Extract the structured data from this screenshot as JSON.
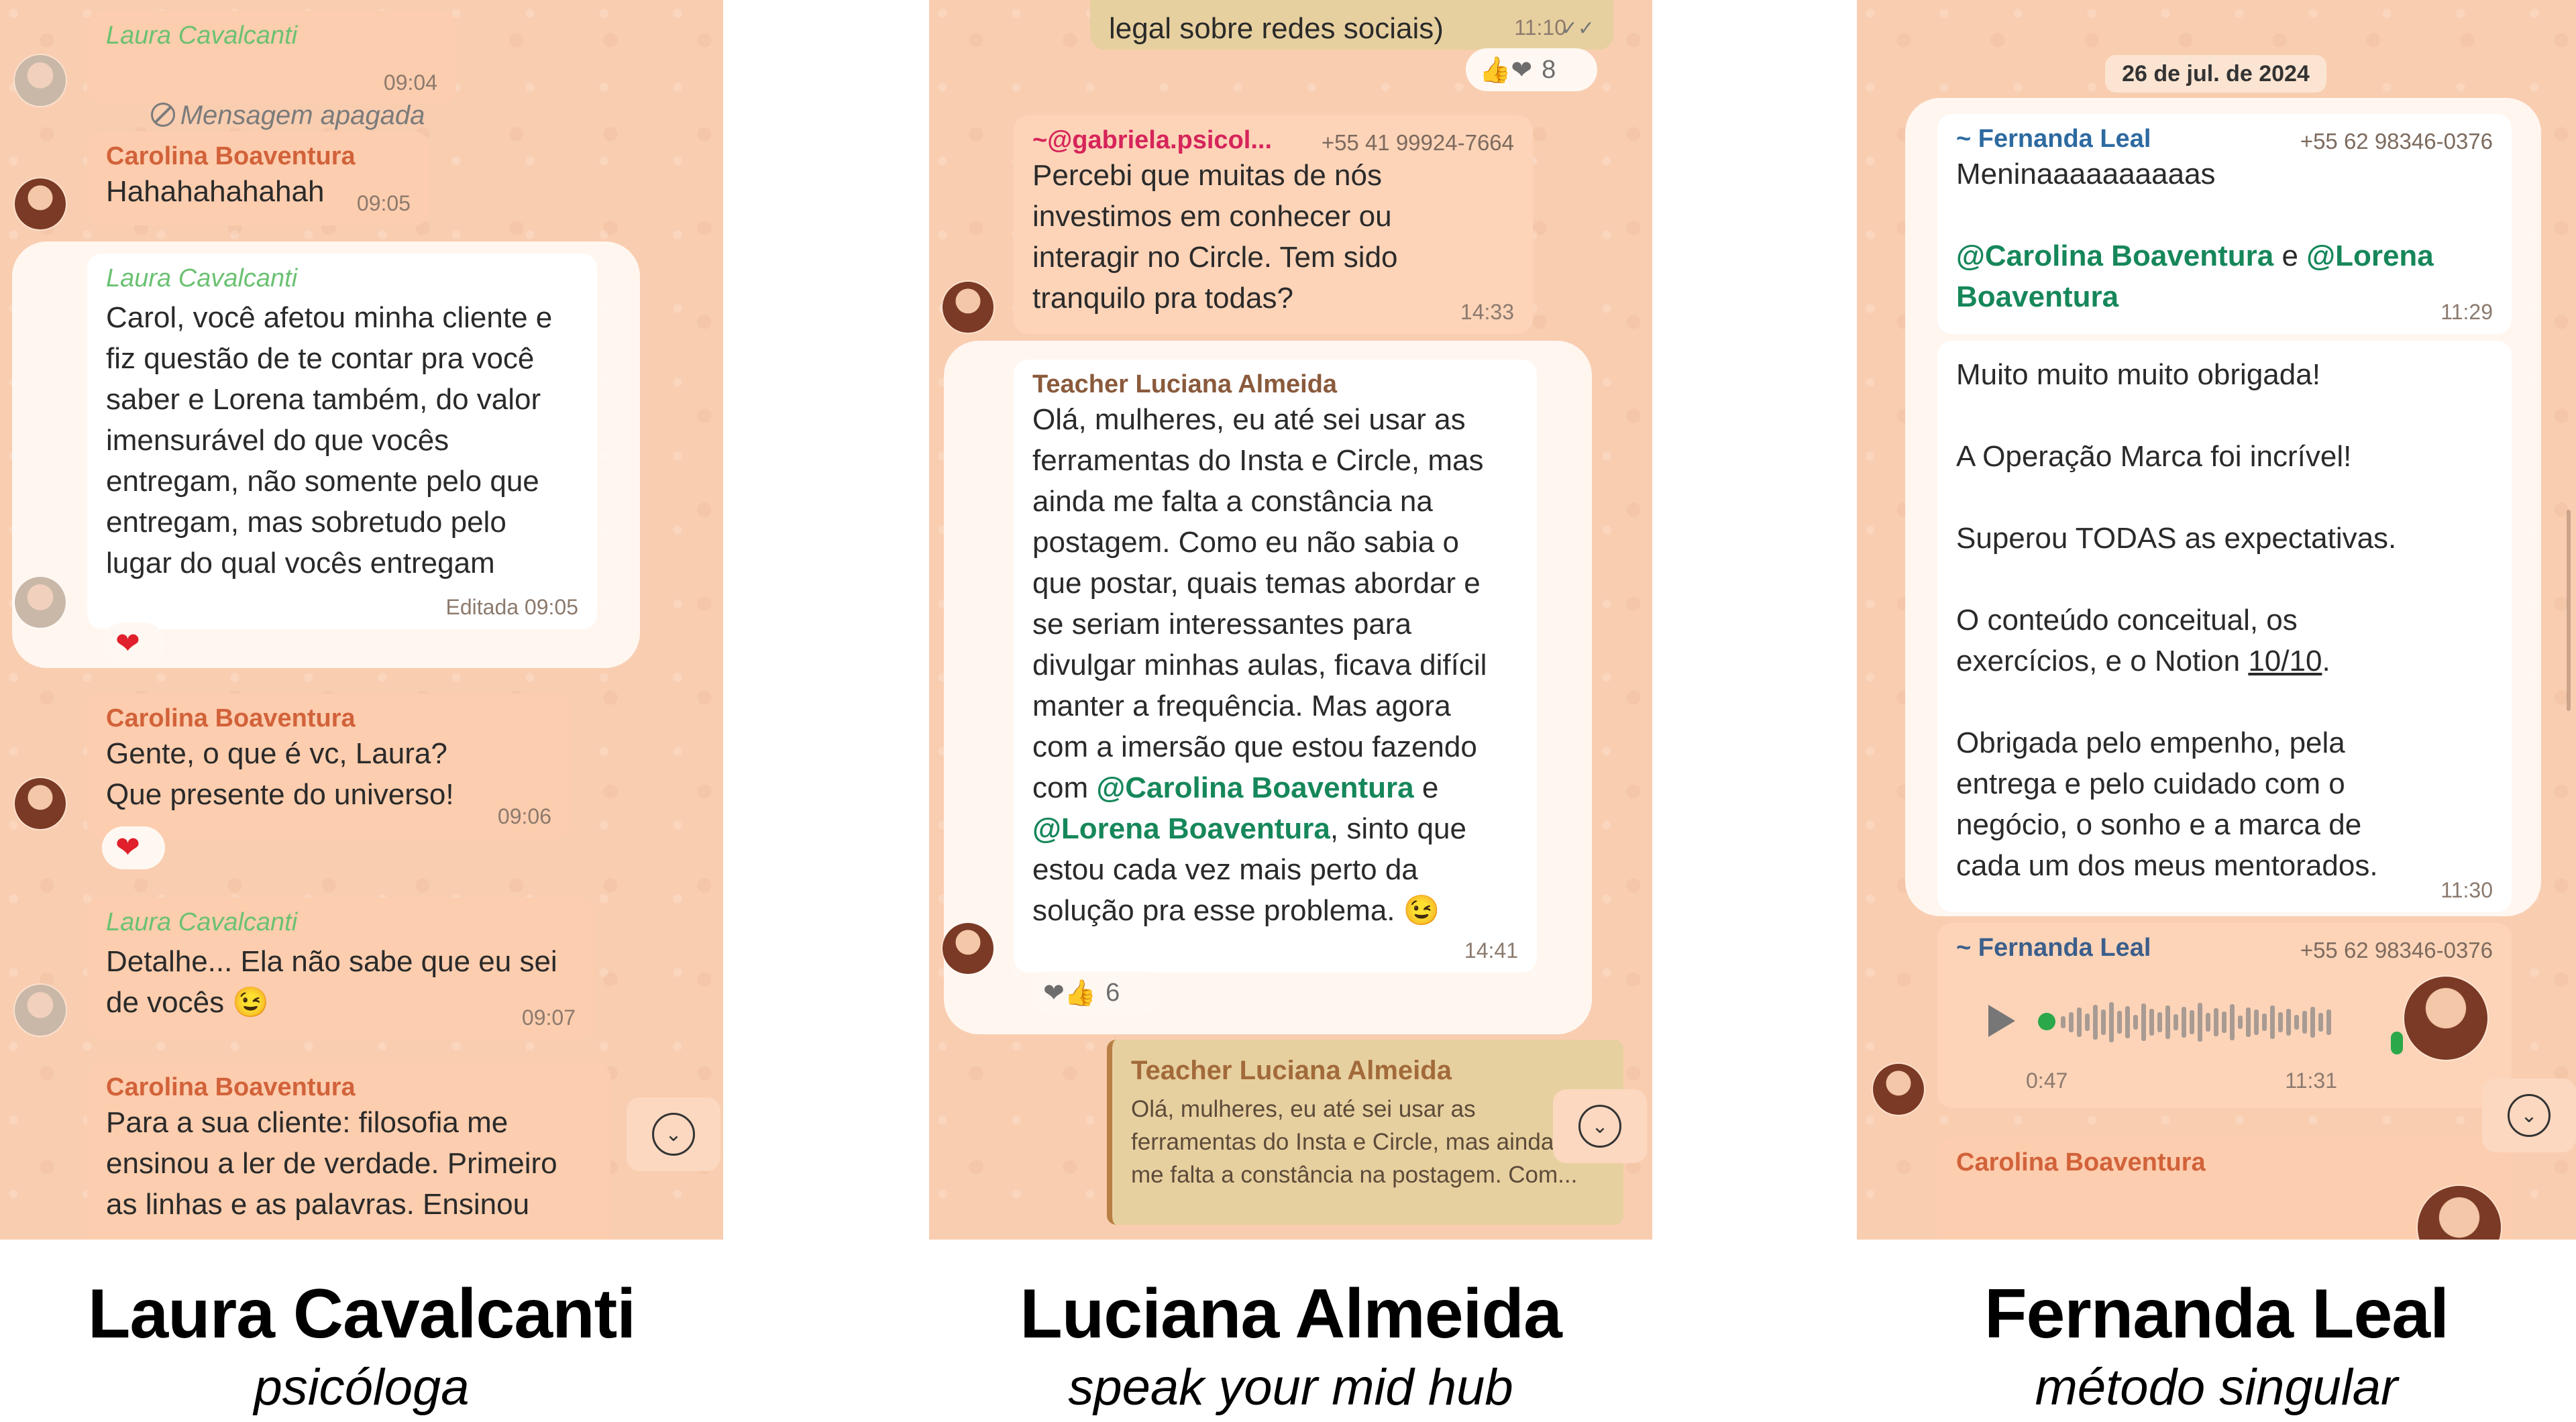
{
  "panels": {
    "laura": {
      "messages": [
        {
          "sender": "Laura Cavalcanti",
          "text": "Mensagem apagada",
          "time": "09:04"
        },
        {
          "sender": "Carolina Boaventura",
          "text": "Hahahahahahah",
          "time": "09:05"
        },
        {
          "sender": "Laura Cavalcanti",
          "text": "Carol, você afetou minha cliente e\nfiz questão de te contar pra você\nsaber e Lorena também, do valor\nimensurável do que vocês\nentregam, não somente pelo que\nentregam, mas sobretudo pelo\nlugar do qual vocês entregam",
          "time": "Editada 09:05",
          "reaction": "❤"
        },
        {
          "sender": "Carolina Boaventura",
          "text": "Gente, o que é vc, Laura?\nQue presente do universo!",
          "time": "09:06",
          "reaction": "❤"
        },
        {
          "sender": "Laura Cavalcanti",
          "text": "Detalhe... Ela não sabe que eu sei\nde vocês 😉",
          "time": "09:07"
        },
        {
          "sender": "Carolina Boaventura",
          "text": "Para a sua cliente: filosofia me\nensinou a ler de verdade. Primeiro\nas linhas e as palavras. Ensinou"
        }
      ]
    },
    "luciana": {
      "top_text": "legal sobre redes sociais)",
      "top_time": "11:10",
      "top_reactions": {
        "emojis": "👍❤",
        "count": "8"
      },
      "gabriela": {
        "sender": "~@gabriela.psicol...",
        "phone": "+55 41 99924-7664",
        "text": "Percebi que muitas de nós\ninvestimos em conhecer ou\ninteragir no Circle. Tem sido\ntranquilo pra todas?",
        "time": "14:33"
      },
      "teacher": {
        "sender": "Teacher Luciana Almeida",
        "text_a": "Olá, mulheres, eu até sei usar as\nferramentas do Insta e Circle, mas\nainda me falta a constância na\npostagem. Como eu não sabia o\nque postar, quais temas abordar e\nse seriam interessantes para\ndivulgar minhas aulas, ficava difícil\nmanter a frequência. Mas agora\ncom a imersão que estou fazendo\ncom ",
        "mention1": "@Carolina Boaventura",
        "text_b": " e\n",
        "mention2": "@Lorena Boaventura",
        "text_c": ", sinto que\nestou cada vez mais perto da\nsolução pra esse problema. 😉",
        "time": "14:41",
        "reactions": {
          "emojis": "❤👍",
          "count": "6"
        }
      },
      "quote": {
        "sender": "Teacher Luciana Almeida",
        "text": "Olá, mulheres, eu até sei usar as\nferramentas do Insta e Circle, mas ainda\nme falta a constância na postagem. Com..."
      }
    },
    "fernanda": {
      "date": "26 de jul. de 2024",
      "msg1": {
        "sender": "~ Fernanda Leal",
        "phone": "+55 62 98346-0376",
        "text": "Meninaaaaaaaaaas",
        "mention1": "@Carolina Boaventura",
        "and": " e ",
        "mention2": "@Lorena Boaventura",
        "time": "11:29"
      },
      "msg2": {
        "text_a": "Muito muito muito obrigada!\n\nA Operação Marca foi incrível!\n\nSuperou TODAS as expectativas.\n\nO conteúdo conceitual, os\nexercícios, e o Notion ",
        "underlined": "10/10",
        "text_b": ".\n\nObrigada pelo empenho, pela\nentrega e pelo cuidado com o\nnegócio, o sonho e a marca de\ncada um dos meus mentorados.",
        "time": "11:30"
      },
      "audio": {
        "sender": "~ Fernanda Leal",
        "phone": "+55 62 98346-0376",
        "duration": "0:47",
        "time": "11:31"
      },
      "last": {
        "sender": "Carolina Boaventura"
      }
    }
  },
  "captions": [
    {
      "name": "Laura Cavalcanti",
      "sub": "psicóloga"
    },
    {
      "name": "Luciana Almeida",
      "sub": "speak your mid hub"
    },
    {
      "name": "Fernanda Leal",
      "sub": "método singular"
    }
  ],
  "colors": {
    "panel_bg": "#f9cdb0",
    "mention": "#16875a",
    "sender_orange": "#d2623a",
    "sender_green": "#6bc172"
  },
  "icons": {
    "scroll_down": "chevron-down-icon",
    "play": "play-icon",
    "mic": "mic-icon",
    "deleted": "block-icon",
    "read": "double-check-icon"
  }
}
